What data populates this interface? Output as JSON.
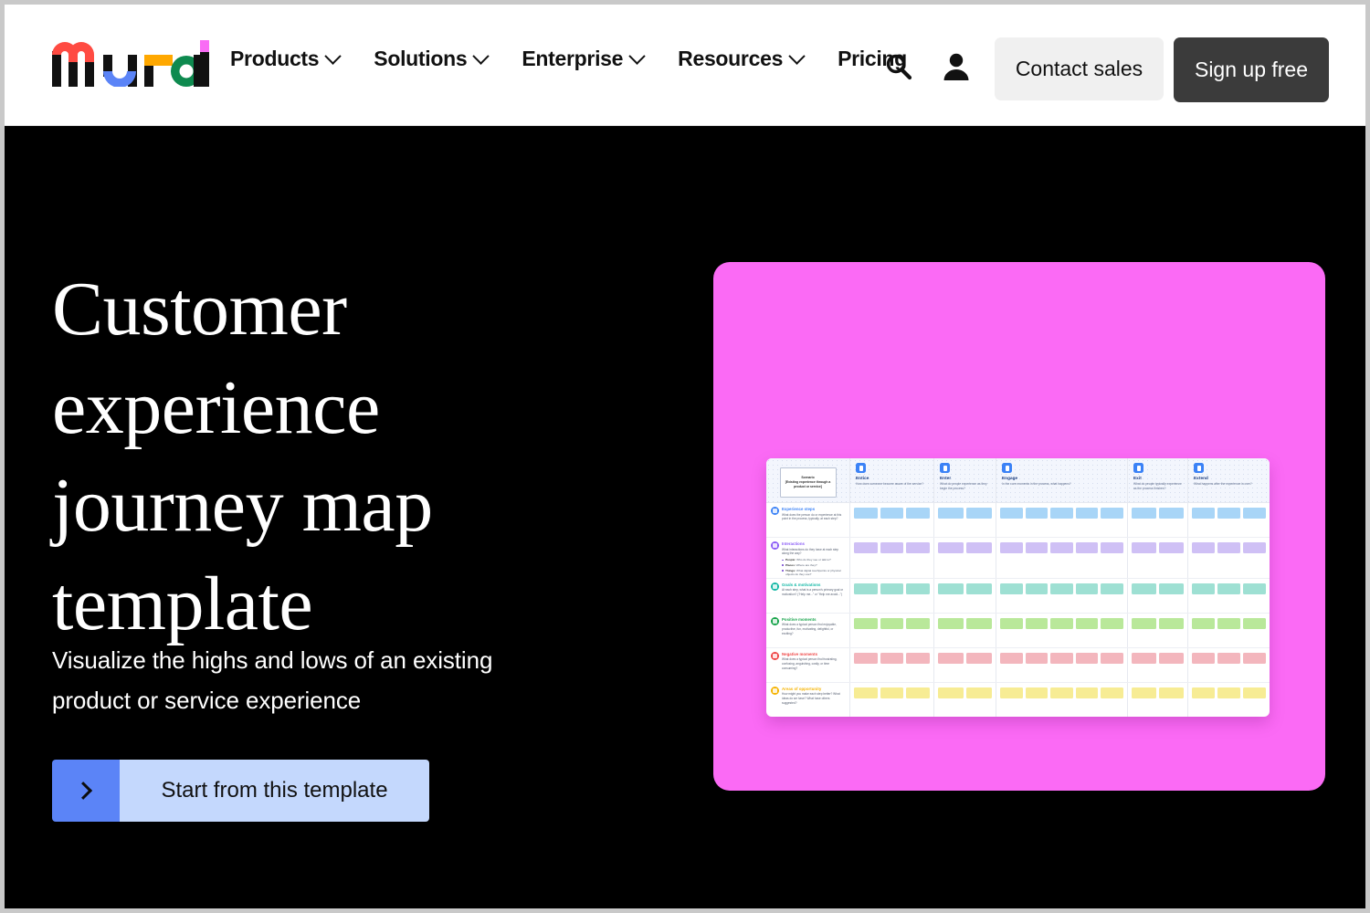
{
  "nav": {
    "logo_text": "mural",
    "items": [
      {
        "label": "Products",
        "has_chevron": true
      },
      {
        "label": "Solutions",
        "has_chevron": true
      },
      {
        "label": "Enterprise",
        "has_chevron": true
      },
      {
        "label": "Resources",
        "has_chevron": true
      },
      {
        "label": "Pricing",
        "has_chevron": false
      }
    ],
    "search_icon": "search-icon",
    "account_icon": "user-icon",
    "contact_label": "Contact sales",
    "signup_label": "Sign up free"
  },
  "hero": {
    "title": "Customer experience journey map template",
    "subtitle": "Visualize the highs and lows of an existing product or service experience",
    "cta_label": "Start from this template",
    "cta_icon": "chevron-right-icon",
    "background_color": "#000000",
    "cta_arrow_color": "#5b84f7",
    "cta_body_color": "#c4d8fd"
  },
  "preview": {
    "background_color": "#fb6af5",
    "scenario": {
      "title": "Scenario",
      "body": "[Existing experience through a product or service]"
    },
    "columns": [
      {
        "title": "Entice",
        "desc": "How does someone become aware of the service?",
        "icon": "billboard-icon",
        "notes": 3
      },
      {
        "title": "Enter",
        "desc": "What do people experience as they begin the process?",
        "icon": "enter-door-icon",
        "notes": 2
      },
      {
        "title": "Engage",
        "desc": "In the core moments in the process, what happens?",
        "icon": "engage-icon",
        "notes": 5
      },
      {
        "title": "Exit",
        "desc": "What do people typically experience as the process finishes?",
        "icon": "exit-door-icon",
        "notes": 2
      },
      {
        "title": "Extend",
        "desc": "What happens after the experience is over?",
        "icon": "clock-icon",
        "notes": 3
      }
    ],
    "rows": [
      {
        "name": "Experience steps",
        "desc": "What does the person do or experience at this point in the process, typically, at each step?",
        "icon": "people-group-icon",
        "icon_color": "#3b82f6",
        "note_color": "#a8d5f7",
        "bullets": []
      },
      {
        "name": "Interactions",
        "desc": "What interactions do they have at each step along the way?",
        "icon": "pointer-hand-icon",
        "icon_color": "#8b5cf6",
        "note_color": "#cfc0f5",
        "bullets": [
          {
            "label": "People:",
            "text": "Who do they see or talk to?"
          },
          {
            "label": "Places:",
            "text": "Where are they?"
          },
          {
            "label": "Things:",
            "text": "What digital touchpoints or physical objects do they use?"
          }
        ]
      },
      {
        "name": "Goals & motivations",
        "desc": "At each step, what is a person's primary goal or motivation? (\"Help me...\" or \"Help me avoid...\")",
        "icon": "target-goal-icon",
        "icon_color": "#14b8a6",
        "note_color": "#9ee0d3",
        "bullets": []
      },
      {
        "name": "Positive moments",
        "desc": "What does a typical person find enjoyable, productive, fun, motivating, delightful, or exciting?",
        "icon": "smiley-happy-icon",
        "icon_color": "#16a34a",
        "note_color": "#b9e89a",
        "bullets": []
      },
      {
        "name": "Negative moments",
        "desc": "What does a typical person find frustrating, confusing, anguishing, costly, or time consuming?",
        "icon": "smiley-sad-icon",
        "icon_color": "#ef4444",
        "note_color": "#f3b6bd",
        "bullets": []
      },
      {
        "name": "Areas of opportunity",
        "desc": "How might you make each step better? What ideas do we have? What have others suggested?",
        "icon": "lightbulb-icon",
        "icon_color": "#f5b301",
        "note_color": "#f7ec94",
        "bullets": []
      }
    ]
  }
}
